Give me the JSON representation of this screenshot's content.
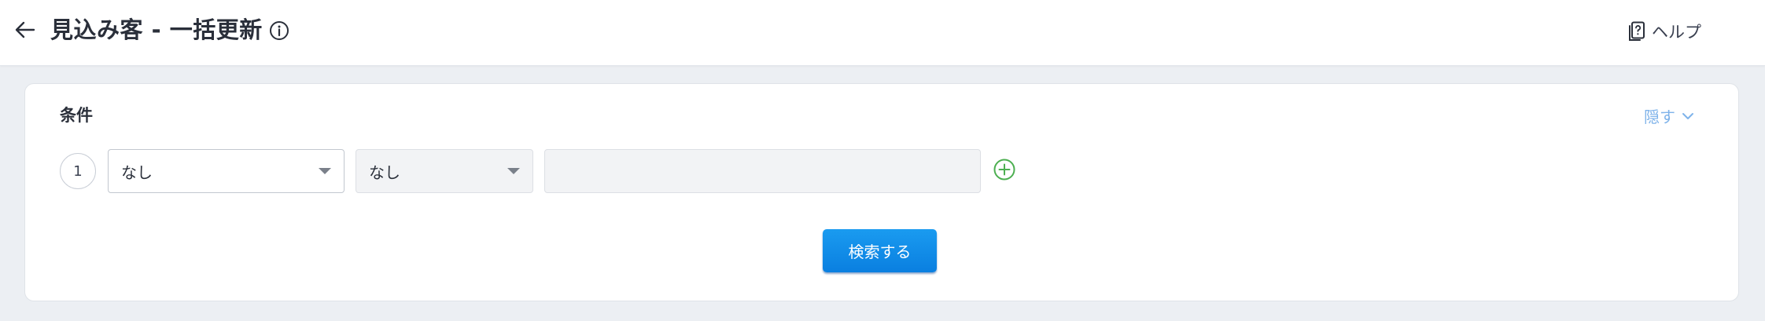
{
  "header": {
    "title": "見込み客 - 一括更新",
    "help_label": "ヘルプ"
  },
  "conditions": {
    "section_title": "条件",
    "toggle_label": "隠す",
    "rows": [
      {
        "number": "1",
        "field_select": "なし",
        "operator_select": "なし",
        "value": ""
      }
    ],
    "search_button": "検索する"
  },
  "colors": {
    "accent": "#0a8ae8",
    "hide_link": "#7fb3ea",
    "add_icon": "#4caf50",
    "background": "#eceff3"
  },
  "icons": {
    "back": "arrow-left-icon",
    "info": "info-circle-icon",
    "help": "help-document-icon",
    "toggle": "chevron-down-icon",
    "add": "plus-circle-icon"
  }
}
